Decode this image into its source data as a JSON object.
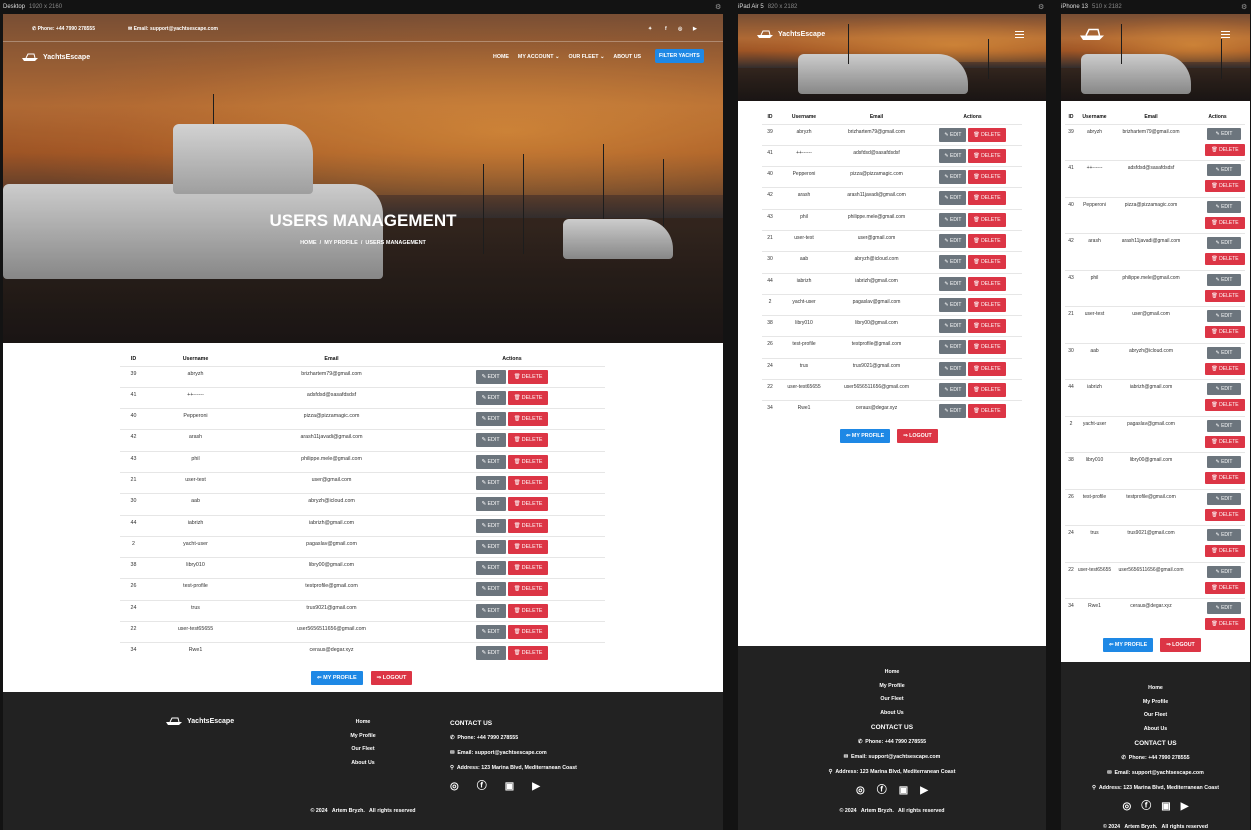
{
  "frames": {
    "desktop": {
      "name": "Desktop",
      "size": "1920 x 2160"
    },
    "ipad": {
      "name": "iPad Air 5",
      "size": "820 x 2182"
    },
    "iphone": {
      "name": "iPhone 13",
      "size": "510 x 2182"
    }
  },
  "topbar": {
    "phone": "Phone: +44 7990 278555",
    "email": "Email: support@yachtsescape.com"
  },
  "brand": "YachtsEscape",
  "nav": {
    "home": "HOME",
    "account": "MY ACCOUNT",
    "fleet": "OUR FLEET",
    "about": "ABOUT US",
    "filter": "FILTER YACHTS",
    "caret": "⌄"
  },
  "hero": {
    "title": "USERS MANAGEMENT",
    "crumb_home": "HOME",
    "crumb_profile": "MY PROFILE",
    "crumb_current": "USERS MANAGEMENT",
    "sep": "/"
  },
  "table": {
    "headers": [
      "ID",
      "Username",
      "Email",
      "Actions"
    ],
    "rows": [
      {
        "id": "39",
        "username": "abryzh",
        "email": "brizhartem79@gmail.com"
      },
      {
        "id": "41",
        "username": "++------",
        "email": "adsfdsd@sasafdsdsf"
      },
      {
        "id": "40",
        "username": "Pepperoni",
        "email": "pizza@pizzamagic.com"
      },
      {
        "id": "42",
        "username": "arash",
        "email": "arash11javadi@gmail.com"
      },
      {
        "id": "43",
        "username": "phil",
        "email": "philippe.mele@gmail.com"
      },
      {
        "id": "21",
        "username": "user-test",
        "email": "user@gmail.com"
      },
      {
        "id": "30",
        "username": "aab",
        "email": "abryzh@icloud.com"
      },
      {
        "id": "44",
        "username": "iabrizh",
        "email": "iabrizh@gmail.com"
      },
      {
        "id": "2",
        "username": "yacht-user",
        "email": "pagaslav@gmail.com"
      },
      {
        "id": "38",
        "username": "libry010",
        "email": "libry00@gmail.com"
      },
      {
        "id": "26",
        "username": "test-profile",
        "email": "testprofile@gmail.com"
      },
      {
        "id": "24",
        "username": "trus",
        "email": "trus9021@gmail.com"
      },
      {
        "id": "22",
        "username": "user-test65655",
        "email": "user5656511656@gmail.com"
      },
      {
        "id": "34",
        "username": "Rwe1",
        "email": "ceraus@degar.xyz"
      }
    ],
    "edit": "✎ EDIT",
    "delete": "🗑 DELETE"
  },
  "actions": {
    "profile": "⇐ MY PROFILE",
    "logout": "⇒ LOGOUT"
  },
  "footer": {
    "links": [
      "Home",
      "My Profile",
      "Our Fleet",
      "About Us"
    ],
    "contact_title": "CONTACT US",
    "phone": "Phone: +44 7990 278555",
    "email": "Email: support@yachtsescape.com",
    "address": "Address: 123 Marina Blvd, Mediterranean Coast",
    "copyright": "© 2024   Artem Bryzh.   All rights reserved"
  },
  "icons": {
    "twitter": "twitter-icon",
    "facebook": "facebook-icon",
    "instagram": "instagram-icon",
    "youtube": "youtube-icon"
  },
  "colors": {
    "primary": "#1e88e5",
    "danger": "#dc3545",
    "secondary": "#6c757d",
    "footer": "#222222"
  }
}
